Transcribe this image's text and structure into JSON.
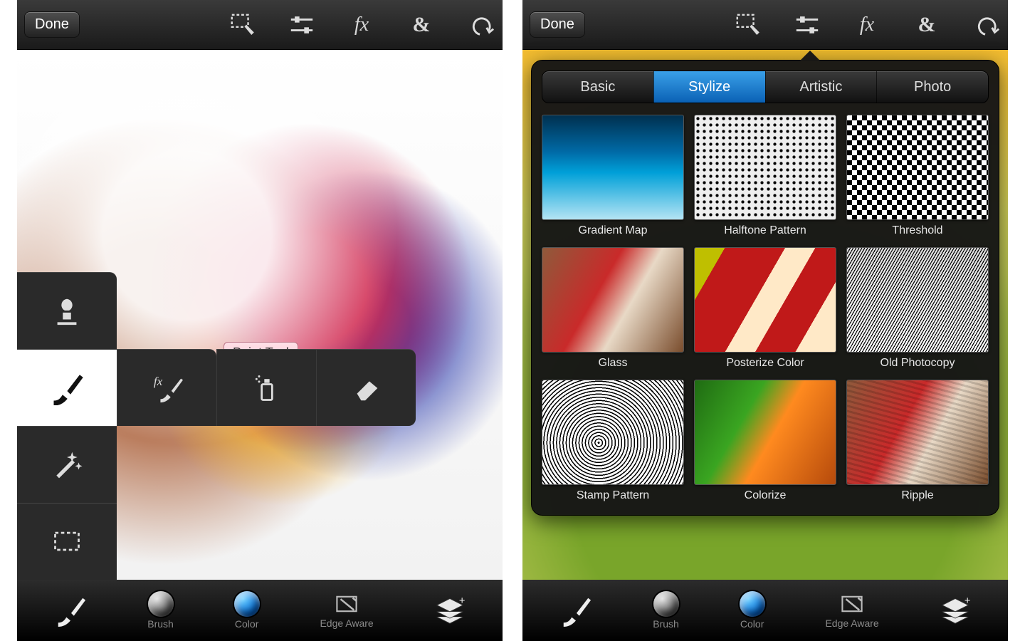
{
  "left": {
    "top": {
      "done": "Done"
    },
    "tooltip": "Paint Tool",
    "bottom": {
      "brush": "Brush",
      "color": "Color",
      "edge": "Edge Aware"
    }
  },
  "right": {
    "top": {
      "done": "Done"
    },
    "tabs": [
      "Basic",
      "Stylize",
      "Artistic",
      "Photo"
    ],
    "selected_tab": 1,
    "effects": [
      "Gradient Map",
      "Halftone Pattern",
      "Threshold",
      "Glass",
      "Posterize Color",
      "Old Photocopy",
      "Stamp Pattern",
      "Colorize",
      "Ripple"
    ],
    "bottom": {
      "brush": "Brush",
      "color": "Color",
      "edge": "Edge Aware"
    }
  }
}
